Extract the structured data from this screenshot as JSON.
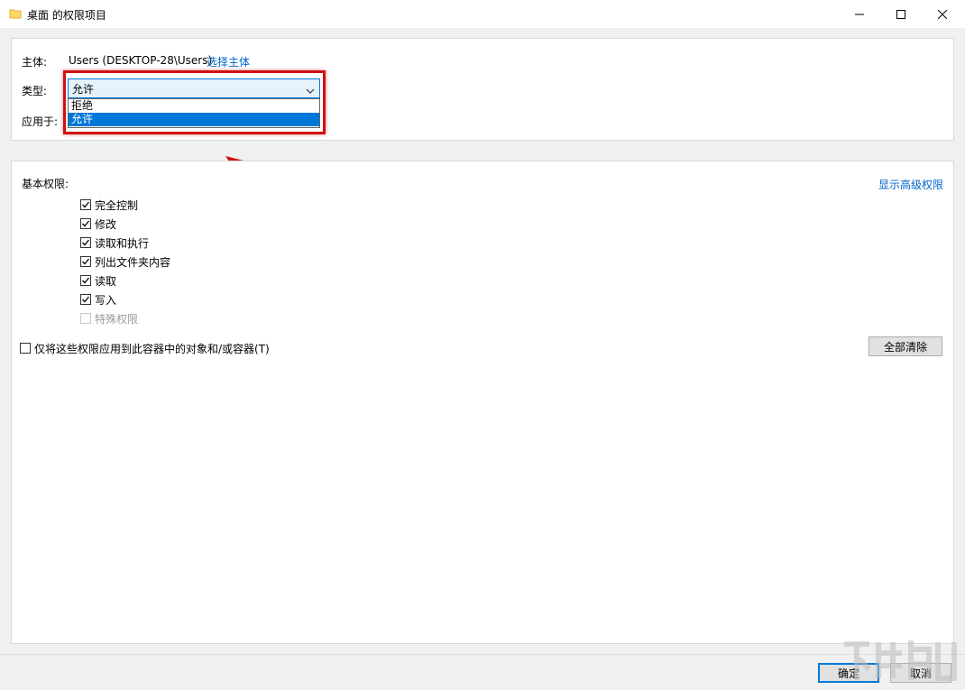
{
  "window": {
    "title": "桌面 的权限项目",
    "folder_icon": "folder-icon",
    "controls": [
      "minimize-icon",
      "maximize-icon",
      "close-icon"
    ]
  },
  "principal": {
    "label": "主体:",
    "value": "Users (DESKTOP-28\\Users)",
    "select_link": "选择主体"
  },
  "type": {
    "label": "类型:",
    "selected": "允许",
    "options": [
      "拒绝",
      "允许"
    ],
    "highlighted_option": "允许"
  },
  "applies_to": {
    "label": "应用于:"
  },
  "basic_permissions": {
    "label": "基本权限:",
    "advanced_link": "显示高级权限",
    "items": [
      {
        "label": "完全控制",
        "checked": true,
        "enabled": true
      },
      {
        "label": "修改",
        "checked": true,
        "enabled": true
      },
      {
        "label": "读取和执行",
        "checked": true,
        "enabled": true
      },
      {
        "label": "列出文件夹内容",
        "checked": true,
        "enabled": true
      },
      {
        "label": "读取",
        "checked": true,
        "enabled": true
      },
      {
        "label": "写入",
        "checked": true,
        "enabled": true
      },
      {
        "label": "特殊权限",
        "checked": false,
        "enabled": false
      }
    ],
    "only_apply_label": "仅将这些权限应用到此容器中的对象和/或容器(T)",
    "only_apply_checked": false,
    "clear_all_button": "全部清除"
  },
  "footer": {
    "ok_button": "确定",
    "cancel_button": "取消"
  },
  "colors": {
    "annotation_red": "#d01010",
    "link_blue": "#0066cc",
    "selection_blue": "#0078d7"
  }
}
